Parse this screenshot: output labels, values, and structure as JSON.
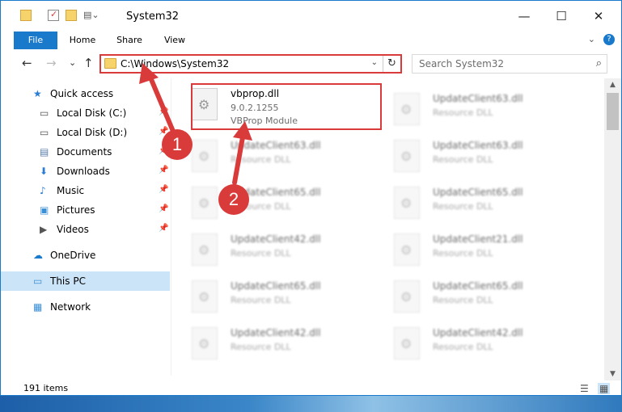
{
  "window": {
    "title": "System32",
    "minimize_glyph": "—",
    "maximize_glyph": "☐",
    "close_glyph": "✕"
  },
  "ribbon": {
    "tabs": [
      "File",
      "Home",
      "Share",
      "View"
    ],
    "expand_glyph": "⌄",
    "help_glyph": "?"
  },
  "address": {
    "back_glyph": "←",
    "forward_glyph": "→",
    "recent_glyph": "⌄",
    "up_glyph": "↑",
    "path": "C:\\Windows\\System32",
    "dropdown_glyph": "⌄",
    "refresh_glyph": "↻"
  },
  "search": {
    "placeholder": "Search System32",
    "icon_glyph": "⌕"
  },
  "nav_pane": {
    "items": [
      {
        "label": "Quick access",
        "icon": "star-icon",
        "glyph": "★",
        "color": "#2b7cd3"
      },
      {
        "label": "Local Disk (C:)",
        "icon": "drive-icon",
        "glyph": "▭",
        "color": "#555555",
        "pin": "📌"
      },
      {
        "label": "Local Disk (D:)",
        "icon": "drive-icon",
        "glyph": "▭",
        "color": "#555555",
        "pin": "📌"
      },
      {
        "label": "Documents",
        "icon": "documents-icon",
        "glyph": "▤",
        "color": "#5a7fa8",
        "pin": "📌"
      },
      {
        "label": "Downloads",
        "icon": "downloads-icon",
        "glyph": "⬇",
        "color": "#2b7cd3",
        "pin": "📌"
      },
      {
        "label": "Music",
        "icon": "music-icon",
        "glyph": "♪",
        "color": "#2b7cd3",
        "pin": "📌"
      },
      {
        "label": "Pictures",
        "icon": "pictures-icon",
        "glyph": "▣",
        "color": "#3a8fd6",
        "pin": "📌"
      },
      {
        "label": "Videos",
        "icon": "videos-icon",
        "glyph": "▶",
        "color": "#555555",
        "pin": "📌"
      },
      {
        "label": "OneDrive",
        "icon": "cloud-icon",
        "glyph": "☁",
        "color": "#1979ca"
      },
      {
        "label": "This PC",
        "icon": "computer-icon",
        "glyph": "▭",
        "color": "#3a8fd6"
      },
      {
        "label": "Network",
        "icon": "network-icon",
        "glyph": "▦",
        "color": "#3a8fd6"
      }
    ]
  },
  "files": {
    "highlighted": {
      "name": "vbprop.dll",
      "version": "9.0.2.1255",
      "description": "VBProp Module"
    },
    "left_column": [
      {
        "name": "UpdateClient63.dll",
        "description": "Resource DLL"
      },
      {
        "name": "UpdateClient65.dll",
        "description": "Resource DLL"
      },
      {
        "name": "UpdateClient42.dll",
        "description": "Resource DLL"
      },
      {
        "name": "UpdateClient65.dll",
        "description": "Resource DLL"
      },
      {
        "name": "UpdateClient42.dll",
        "description": "Resource DLL"
      }
    ],
    "right_column": [
      {
        "name": "UpdateClient63.dll",
        "description": "Resource DLL"
      },
      {
        "name": "UpdateClient63.dll",
        "description": "Resource DLL"
      },
      {
        "name": "UpdateClient65.dll",
        "description": "Resource DLL"
      },
      {
        "name": "UpdateClient21.dll",
        "description": "Resource DLL"
      },
      {
        "name": "UpdateClient65.dll",
        "description": "Resource DLL"
      },
      {
        "name": "UpdateClient42.dll",
        "description": "Resource DLL"
      }
    ]
  },
  "status": {
    "item_count": "191 items"
  },
  "annotations": {
    "step1": "1",
    "step2": "2",
    "color": "#d93a3a"
  }
}
